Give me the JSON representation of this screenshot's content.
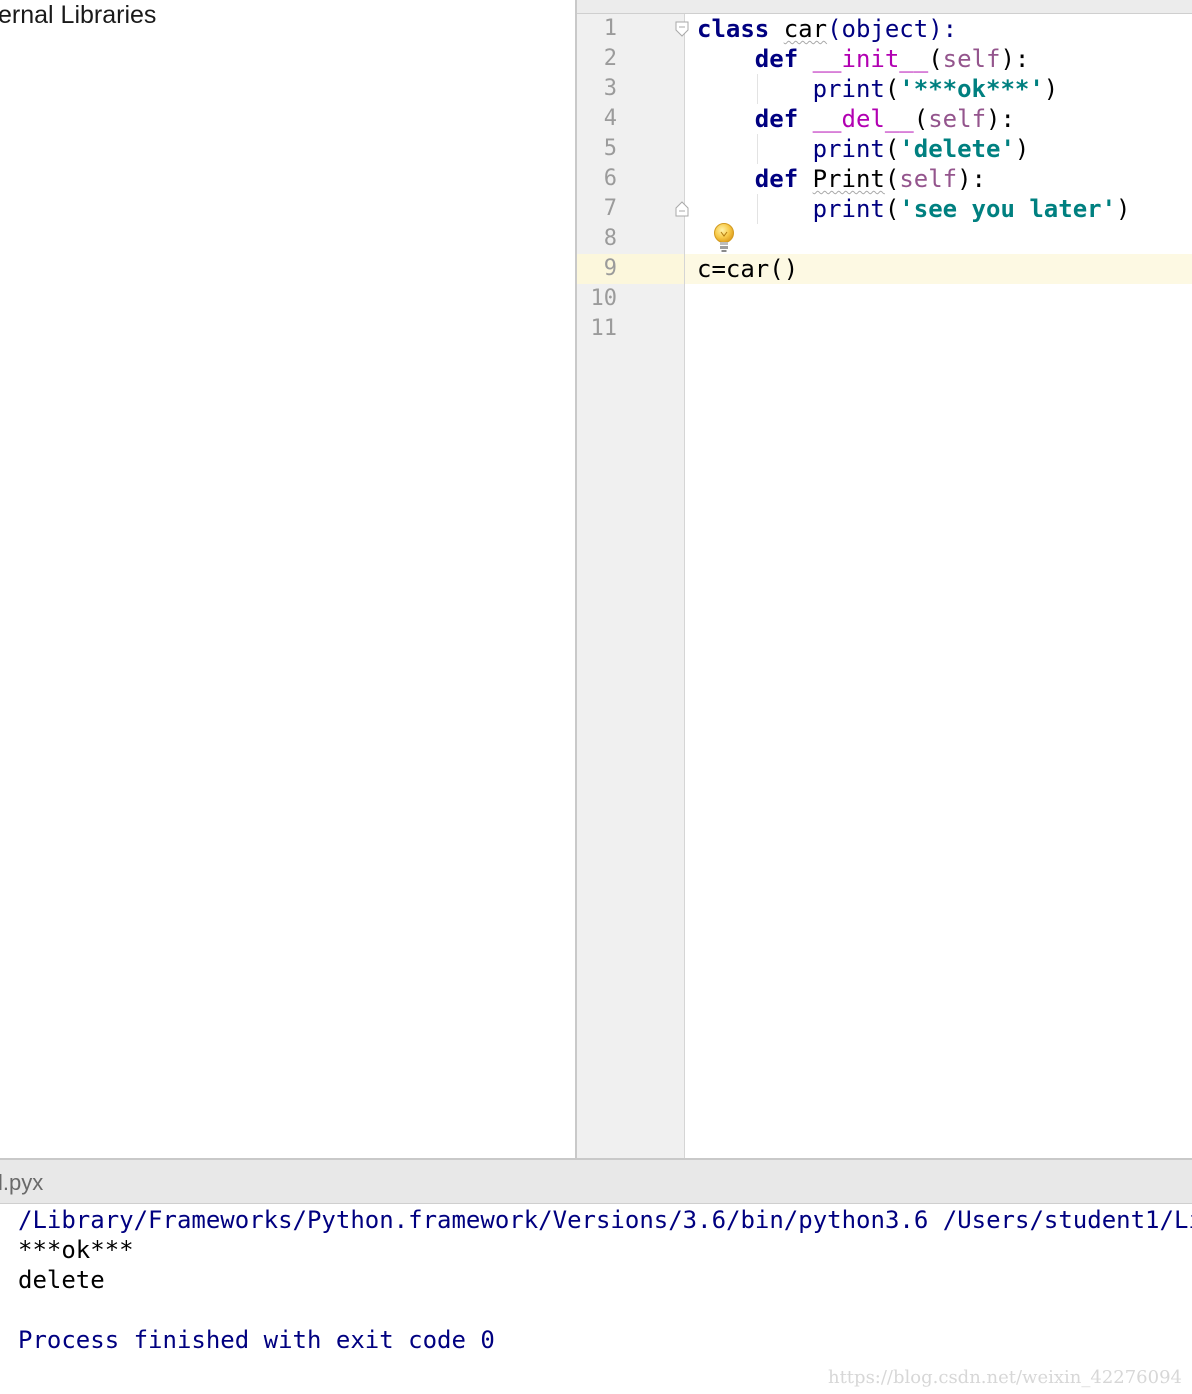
{
  "project": {
    "tree_item_label": "ernal Libraries"
  },
  "editor": {
    "line_numbers": [
      "1",
      "2",
      "3",
      "4",
      "5",
      "6",
      "7",
      "8",
      "9",
      "10",
      "11"
    ],
    "current_line": 9,
    "code": {
      "l1": {
        "kw": "class",
        "name": "car",
        "rest": "(object):"
      },
      "l2": {
        "kw": "def",
        "name": "__init__",
        "open": "(",
        "self": "self",
        "close": "):"
      },
      "l3": {
        "fn": "print",
        "open": "(",
        "str": "'***ok***'",
        "close": ")"
      },
      "l4": {
        "kw": "def",
        "name": "__del__",
        "open": "(",
        "self": "self",
        "close": "):"
      },
      "l5": {
        "fn": "print",
        "open": "(",
        "str": "'delete'",
        "close": ")"
      },
      "l6": {
        "kw": "def",
        "name": "Print",
        "open": "(",
        "self": "self",
        "close": "):"
      },
      "l7": {
        "fn": "print",
        "open": "(",
        "str": "'see you later'",
        "close": ")"
      },
      "l9": {
        "text": "c=car()"
      }
    },
    "icons": [
      "fold-start-icon",
      "fold-end-icon",
      "lightbulb-icon"
    ]
  },
  "run": {
    "title": "l.pyx",
    "output": {
      "command": "/Library/Frameworks/Python.framework/Versions/3.6/bin/python3.6 /Users/student1/Library",
      "line1": "***ok***",
      "line2": "delete",
      "exit_message": "Process finished with exit code 0"
    },
    "watermark": "https://blog.csdn.net/weixin_42276094"
  },
  "colors": {
    "keyword": "#000080",
    "dunder": "#b200b2",
    "self": "#94558d",
    "string": "#008080",
    "current_line": "#fdf9e3",
    "gutter": "#f0f0f0"
  }
}
